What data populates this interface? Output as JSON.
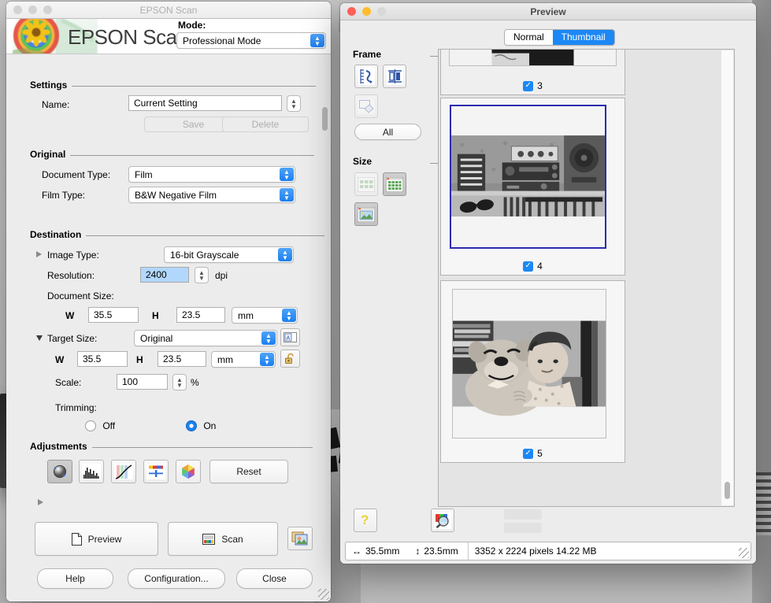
{
  "epson": {
    "window_title": "EPSON Scan",
    "wordmark": "EPSON Scan",
    "mode_label": "Mode:",
    "mode_value": "Professional Mode",
    "settings": {
      "group": "Settings",
      "name_label": "Name:",
      "name_value": "Current Setting",
      "save_label": "Save",
      "delete_label": "Delete"
    },
    "original": {
      "group": "Original",
      "document_type_label": "Document Type:",
      "document_type_value": "Film",
      "film_type_label": "Film Type:",
      "film_type_value": "B&W Negative Film"
    },
    "destination": {
      "group": "Destination",
      "image_type_label": "Image Type:",
      "image_type_value": "16-bit Grayscale",
      "resolution_label": "Resolution:",
      "resolution_value": "2400",
      "resolution_unit": "dpi",
      "document_size_label": "Document Size:",
      "doc_w_label": "W",
      "doc_w_value": "35.5",
      "doc_h_label": "H",
      "doc_h_value": "23.5",
      "doc_unit": "mm",
      "target_size_label": "Target Size:",
      "target_size_value": "Original",
      "tgt_w_label": "W",
      "tgt_w_value": "35.5",
      "tgt_h_label": "H",
      "tgt_h_value": "23.5",
      "tgt_unit": "mm",
      "scale_label": "Scale:",
      "scale_value": "100",
      "scale_unit": "%",
      "trimming_label": "Trimming:",
      "trimming_off": "Off",
      "trimming_on": "On"
    },
    "adjustments": {
      "group": "Adjustments",
      "reset_label": "Reset",
      "tools": [
        {
          "name": "auto-exposure-icon"
        },
        {
          "name": "histogram-icon"
        },
        {
          "name": "tone-curve-icon"
        },
        {
          "name": "image-adjustment-icon"
        },
        {
          "name": "color-palette-icon"
        }
      ]
    },
    "actions": {
      "preview_label": "Preview",
      "scan_label": "Scan",
      "help_label": "Help",
      "configuration_label": "Configuration...",
      "close_label": "Close"
    }
  },
  "preview": {
    "window_title": "Preview",
    "tabs": [
      {
        "label": "Normal",
        "active": false
      },
      {
        "label": "Thumbnail",
        "active": true
      }
    ],
    "frame": {
      "group": "Frame",
      "all_label": "All"
    },
    "size": {
      "group": "Size"
    },
    "thumbnails": [
      {
        "number": "3",
        "checked": true,
        "selected": false
      },
      {
        "number": "4",
        "checked": true,
        "selected": true
      },
      {
        "number": "5",
        "checked": true,
        "selected": false
      }
    ],
    "status": {
      "width": "35.5mm",
      "height": "23.5mm",
      "pixels": "3352 x 2224 pixels 14.22 MB"
    }
  },
  "colors": {
    "accent": "#1c88f5",
    "selection": "#b2d7fd",
    "frame_selected": "#2b2bb0"
  }
}
